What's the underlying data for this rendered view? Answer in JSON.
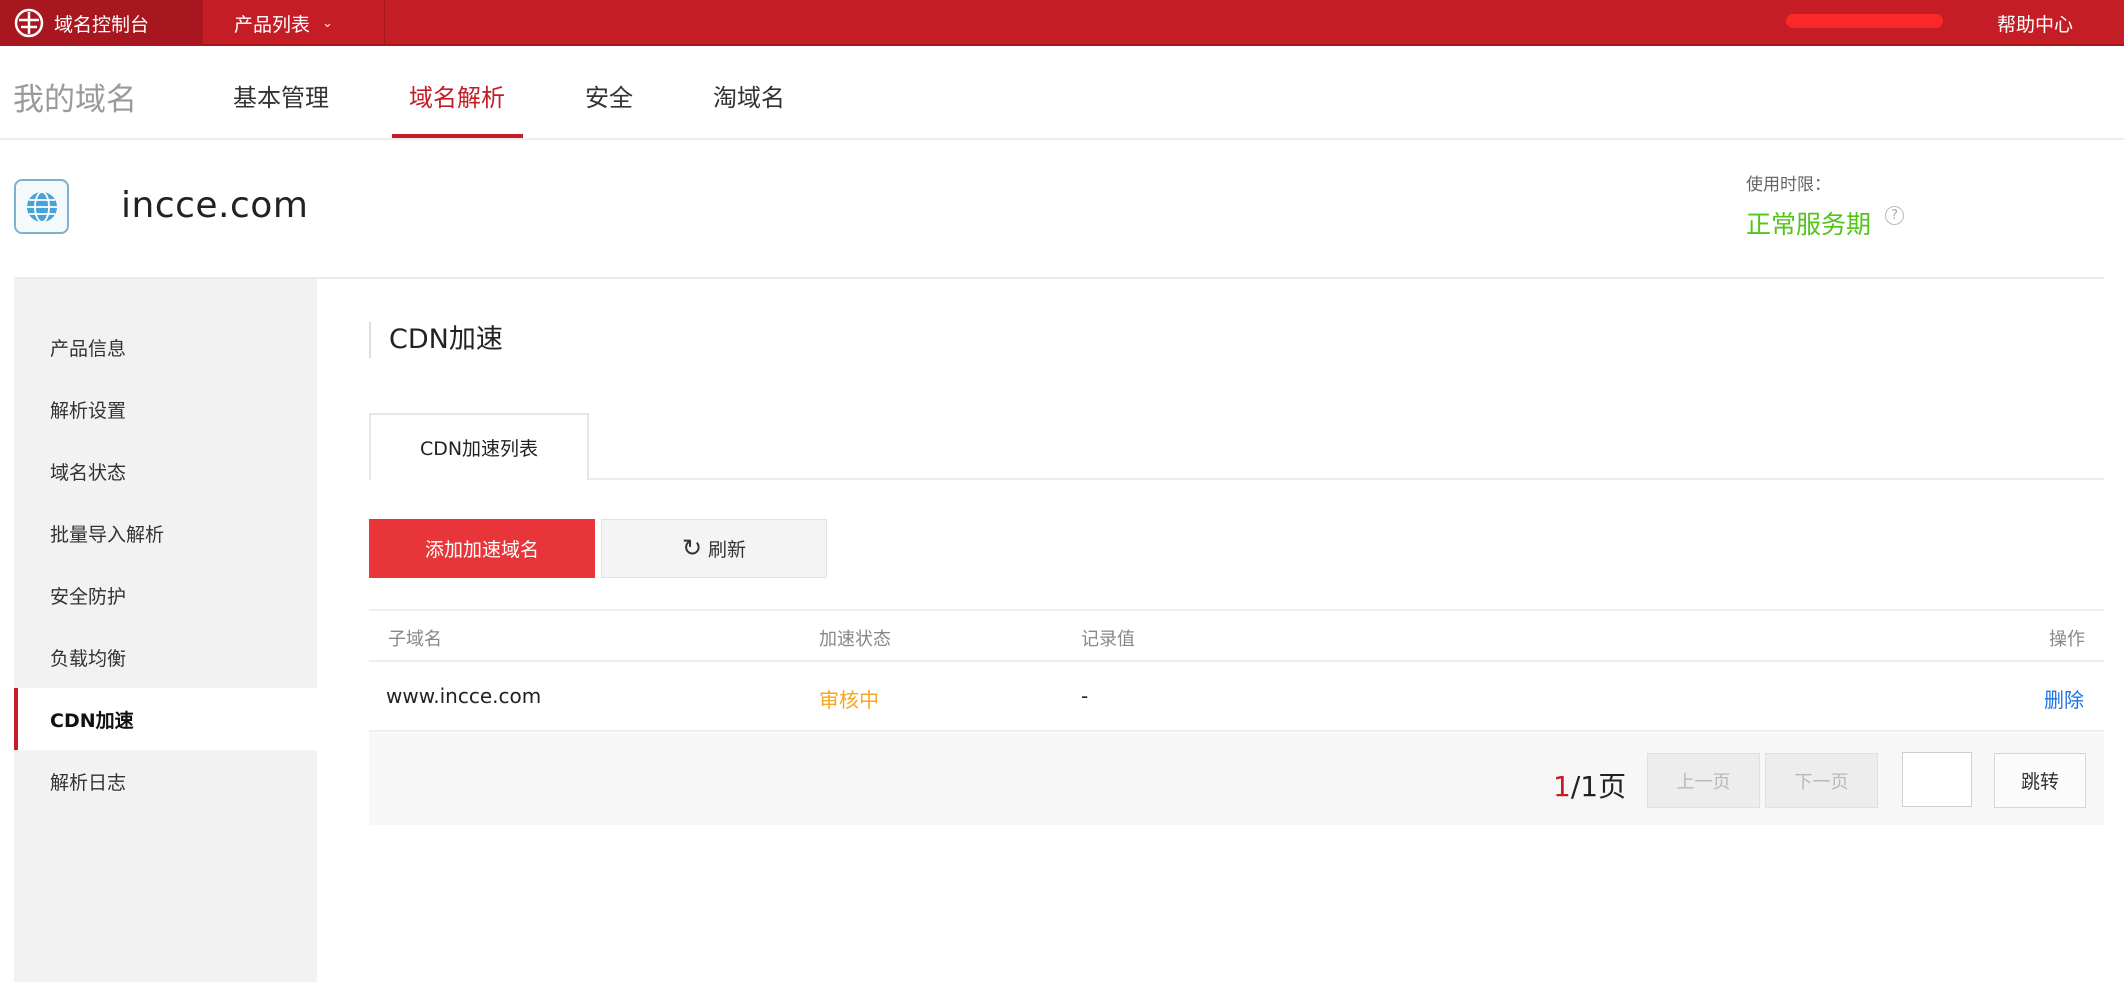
{
  "topbar": {
    "brand": "域名控制台",
    "product_list": "产品列表",
    "account": "",
    "help": "帮助中心"
  },
  "subnav": {
    "title": "我的域名",
    "tabs": [
      {
        "label": "基本管理",
        "active": false
      },
      {
        "label": "域名解析",
        "active": true
      },
      {
        "label": "安全",
        "active": false
      },
      {
        "label": "淘域名",
        "active": false
      }
    ]
  },
  "domain": {
    "name": "incce.com",
    "usage_label": "使用时限：",
    "usage_value": "正常服务期"
  },
  "sidebar": {
    "items": [
      {
        "label": "产品信息",
        "active": false
      },
      {
        "label": "解析设置",
        "active": false
      },
      {
        "label": "域名状态",
        "active": false
      },
      {
        "label": "批量导入解析",
        "active": false
      },
      {
        "label": "安全防护",
        "active": false
      },
      {
        "label": "负载均衡",
        "active": false
      },
      {
        "label": "CDN加速",
        "active": true
      },
      {
        "label": "解析日志",
        "active": false
      }
    ]
  },
  "main": {
    "title": "CDN加速",
    "tab": "CDN加速列表",
    "add_button": "添加加速域名",
    "refresh_button": "刷新",
    "table": {
      "headers": [
        "子域名",
        "加速状态",
        "记录值",
        "操作"
      ],
      "rows": [
        {
          "subdomain": "www.incce.com",
          "status": "审核中",
          "record": "-",
          "action": "删除"
        }
      ]
    },
    "pager": {
      "current": "1",
      "total": "/1页",
      "prev": "上一页",
      "next": "下一页",
      "goto": "跳转"
    }
  },
  "colors": {
    "brand_red": "#c41d26",
    "button_red": "#e8353a",
    "status_orange": "#f5a623",
    "service_green": "#52c41a",
    "link_blue": "#1a73e8"
  }
}
